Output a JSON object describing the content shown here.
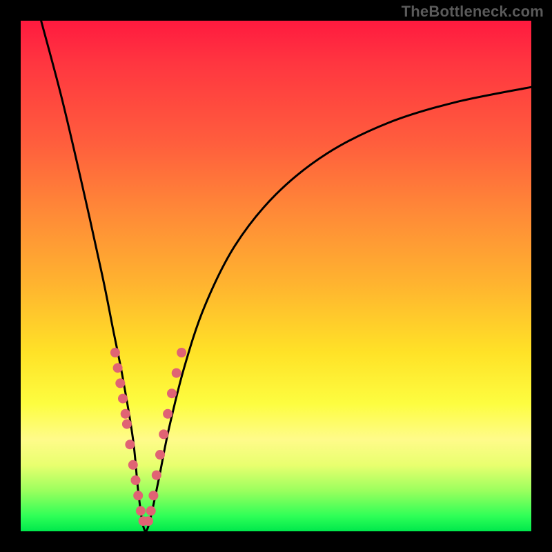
{
  "watermark": "TheBottleneck.com",
  "colors": {
    "frame": "#000000",
    "curve": "#000000",
    "bead": "#e06374",
    "gradient_top": "#ff1a3f",
    "gradient_bottom": "#00e84c"
  },
  "chart_data": {
    "type": "line",
    "title": "",
    "xlabel": "",
    "ylabel": "",
    "xlim": [
      0,
      100
    ],
    "ylim": [
      0,
      100
    ],
    "note": "axes unlabeled; x and y in percent of plot area (0=left/bottom, 100=right/top). Curve is a V-shaped bottleneck profile with minimum ~0 near x≈24.",
    "series": [
      {
        "name": "bottleneck-curve",
        "x": [
          4,
          8,
          12,
          16,
          18,
          20,
          22,
          23,
          24,
          25,
          27,
          29,
          32,
          36,
          42,
          50,
          60,
          72,
          85,
          100
        ],
        "values": [
          100,
          85,
          68,
          50,
          40,
          30,
          18,
          8,
          1,
          1,
          10,
          20,
          32,
          44,
          56,
          66,
          74,
          80,
          84,
          87
        ]
      }
    ],
    "annotations": [
      {
        "name": "beads-left-arm",
        "note": "pink dotted segment on descending arm near bottom",
        "points_xy": [
          [
            18.5,
            35
          ],
          [
            19,
            32
          ],
          [
            19.5,
            29
          ],
          [
            20,
            26
          ],
          [
            20.5,
            23
          ],
          [
            20.8,
            21
          ],
          [
            21.4,
            17
          ],
          [
            22,
            13
          ],
          [
            22.5,
            10
          ],
          [
            23,
            7
          ],
          [
            23.5,
            4
          ],
          [
            24,
            2
          ]
        ]
      },
      {
        "name": "beads-right-arm",
        "note": "pink dotted segment on ascending arm near bottom",
        "points_xy": [
          [
            25,
            2
          ],
          [
            25.5,
            4
          ],
          [
            26,
            7
          ],
          [
            26.6,
            11
          ],
          [
            27.3,
            15
          ],
          [
            28,
            19
          ],
          [
            28.8,
            23
          ],
          [
            29.6,
            27
          ],
          [
            30.5,
            31
          ],
          [
            31.5,
            35
          ]
        ]
      }
    ]
  }
}
